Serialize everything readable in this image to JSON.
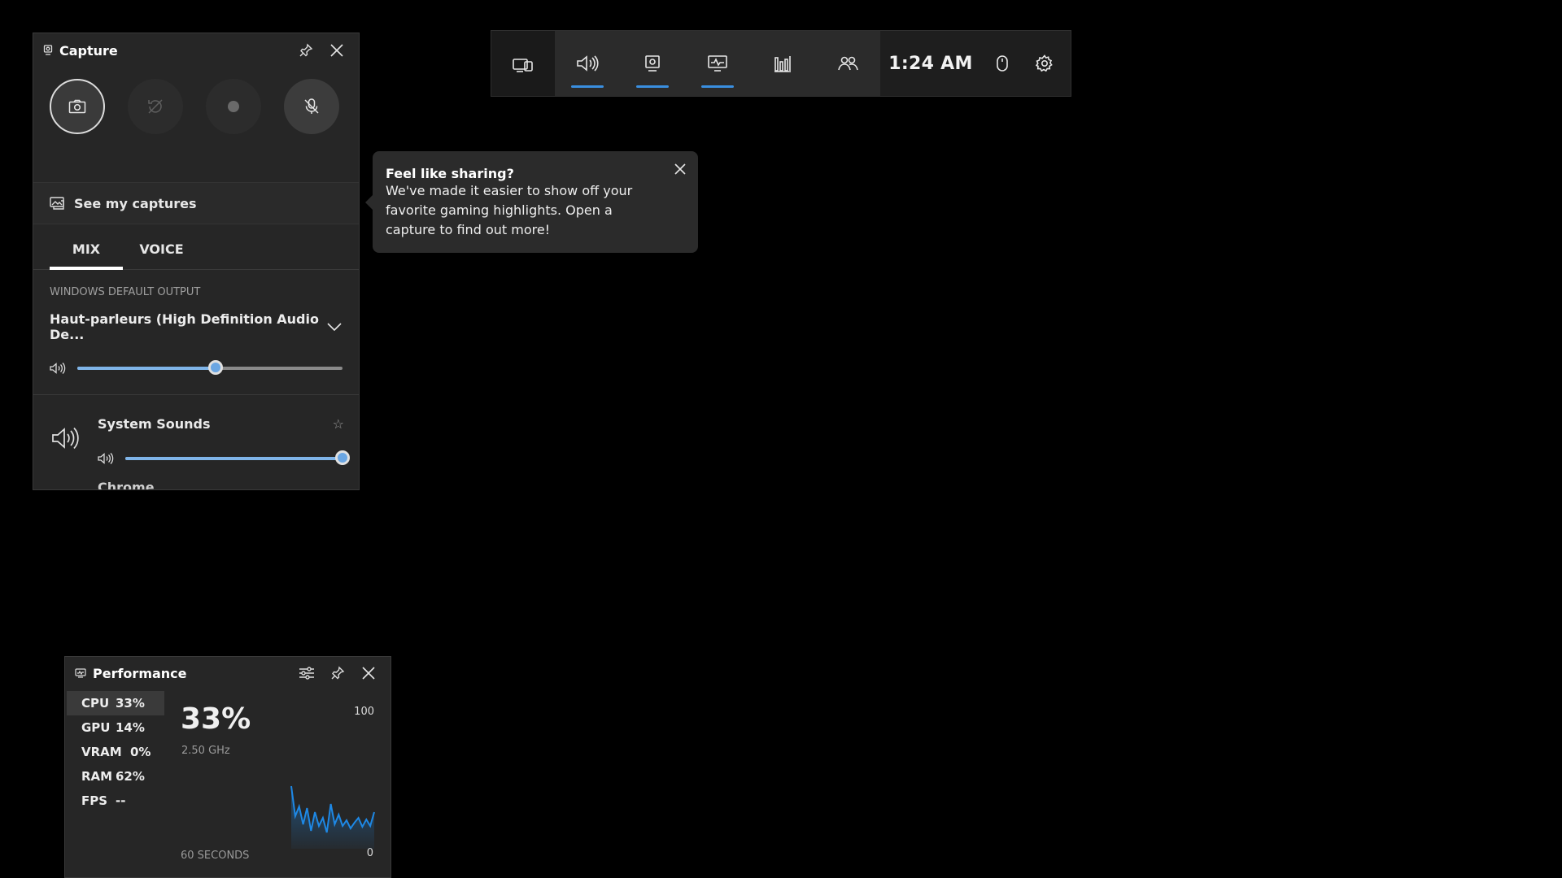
{
  "gamebar": {
    "time": "1:24 AM",
    "buttons": [
      {
        "name": "widget-menu",
        "active": false
      },
      {
        "name": "audio",
        "active": true
      },
      {
        "name": "capture",
        "active": true
      },
      {
        "name": "performance",
        "active": true
      },
      {
        "name": "resources",
        "active": false
      },
      {
        "name": "xbox-social",
        "active": false
      }
    ]
  },
  "capture": {
    "title": "Capture",
    "see_captures": "See my captures"
  },
  "audio": {
    "tab_mix": "MIX",
    "tab_voice": "VOICE",
    "section_label": "WINDOWS DEFAULT OUTPUT",
    "device": "Haut-parleurs (High Definition Audio De...",
    "master_volume": 0.52,
    "apps": [
      {
        "name": "System Sounds",
        "volume": 1.0
      },
      {
        "name": "Chrome"
      }
    ]
  },
  "tooltip": {
    "title": "Feel like sharing?",
    "body": "We've made it easier to show off your favorite gaming highlights. Open a capture to find out more!"
  },
  "performance": {
    "title": "Performance",
    "metrics": [
      {
        "name": "CPU",
        "value": "33%"
      },
      {
        "name": "GPU",
        "value": "14%"
      },
      {
        "name": "VRAM",
        "value": "0%"
      },
      {
        "name": "RAM",
        "value": "62%"
      },
      {
        "name": "FPS",
        "value": "--"
      }
    ],
    "big_value": "33%",
    "frequency": "2.50 GHz",
    "axis_max": "100",
    "axis_min": "0",
    "x_label": "60 SECONDS",
    "series_color": "#1e88e5",
    "series": [
      77,
      40,
      52,
      30,
      50,
      22,
      45,
      28,
      38,
      20,
      55,
      30,
      42,
      28,
      35,
      25,
      32,
      38,
      27,
      36,
      28,
      45
    ]
  }
}
